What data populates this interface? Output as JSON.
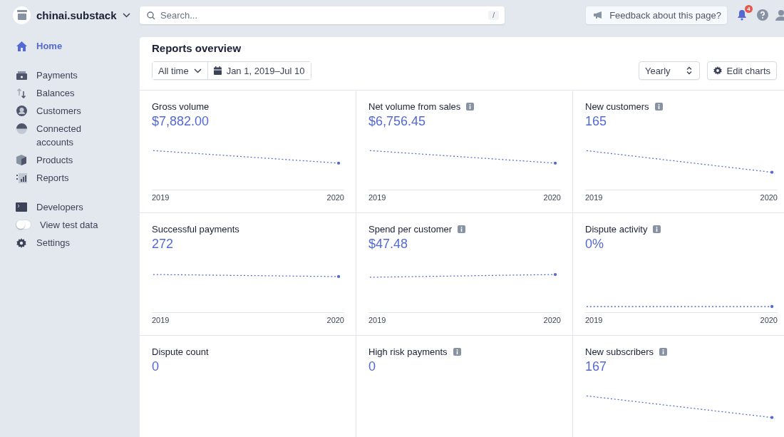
{
  "account": {
    "name": "chinai.substack"
  },
  "search": {
    "placeholder": "Search...",
    "shortcut": "/"
  },
  "feedback": {
    "label": "Feedback about this page?"
  },
  "notifications": {
    "count": "4"
  },
  "sidebar": {
    "groups": [
      [
        {
          "kind": "nav",
          "label": "Home",
          "selected": true
        }
      ],
      [
        {
          "kind": "nav",
          "label": "Payments",
          "selected": false
        },
        {
          "kind": "nav",
          "label": "Balances",
          "selected": false
        },
        {
          "kind": "nav",
          "label": "Customers",
          "selected": false
        },
        {
          "kind": "nav",
          "label": "Connected accounts",
          "selected": false
        },
        {
          "kind": "nav",
          "label": "Products",
          "selected": false
        },
        {
          "kind": "nav",
          "label": "Reports",
          "selected": false
        }
      ],
      [
        {
          "kind": "nav",
          "label": "Developers",
          "selected": false
        },
        {
          "kind": "toggle",
          "label": "View test data",
          "on": false
        },
        {
          "kind": "nav",
          "label": "Settings",
          "selected": false
        }
      ]
    ]
  },
  "reports": {
    "title": "Reports overview",
    "range": "All time",
    "dates": "Jan 1, 2019–Jul 10",
    "interval": "Yearly",
    "edit_button": "Edit charts",
    "cards": [
      {
        "title": "Gross volume",
        "info": false,
        "value": "$7,882.00",
        "x_start": "2019",
        "x_end": "2020"
      },
      {
        "title": "Net volume from sales",
        "info": true,
        "value": "$6,756.45",
        "x_start": "2019",
        "x_end": "2020"
      },
      {
        "title": "New customers",
        "info": true,
        "value": "165",
        "x_start": "2019",
        "x_end": "2020"
      },
      {
        "title": "Successful payments",
        "info": false,
        "value": "272",
        "x_start": "2019",
        "x_end": "2020"
      },
      {
        "title": "Spend per customer",
        "info": true,
        "value": "$47.48",
        "x_start": "2019",
        "x_end": "2020"
      },
      {
        "title": "Dispute activity",
        "info": true,
        "value": "0%",
        "x_start": "2019",
        "x_end": "2020"
      },
      {
        "title": "Dispute count",
        "info": false,
        "value": "0"
      },
      {
        "title": "High risk payments",
        "info": true,
        "value": "0"
      },
      {
        "title": "New subscribers",
        "info": true,
        "value": "167"
      }
    ]
  }
}
